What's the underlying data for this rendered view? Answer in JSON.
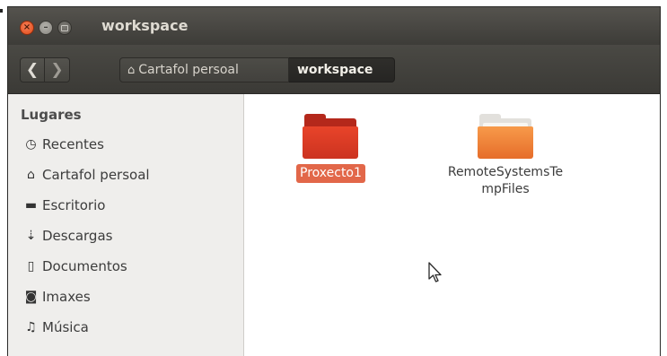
{
  "window": {
    "title": "workspace",
    "controls": {
      "close": "×",
      "minimize": "–"
    }
  },
  "toolbar": {
    "back_glyph": "❮",
    "forward_glyph": "❯",
    "breadcrumbs": [
      {
        "label": "Cartafol persoal",
        "icon": "home-icon",
        "glyph": "⌂"
      },
      {
        "label": "workspace",
        "active": true
      }
    ]
  },
  "sidebar": {
    "heading": "Lugares",
    "items": [
      {
        "label": "Recentes",
        "icon": "clock-icon",
        "glyph": "◷"
      },
      {
        "label": "Cartafol persoal",
        "icon": "home-icon",
        "glyph": "⌂"
      },
      {
        "label": "Escritorio",
        "icon": "desktop-folder-icon",
        "glyph": "▬"
      },
      {
        "label": "Descargas",
        "icon": "download-icon",
        "glyph": "⇣"
      },
      {
        "label": "Documentos",
        "icon": "document-icon",
        "glyph": "▯"
      },
      {
        "label": "Imaxes",
        "icon": "camera-icon",
        "glyph": "◙"
      },
      {
        "label": "Música",
        "icon": "music-icon",
        "glyph": "♫"
      }
    ]
  },
  "files": [
    {
      "name": "Proxecto1",
      "selected": true,
      "icon": "folder-icon"
    },
    {
      "name": "RemoteSystemsTe\nmpFiles",
      "selected": false,
      "icon": "folder-icon"
    }
  ],
  "colors": {
    "accent": "#e26749",
    "titlebar": "#3d3c38",
    "folder_selected": "#e8442a",
    "folder_normal": "#f79a4a"
  }
}
